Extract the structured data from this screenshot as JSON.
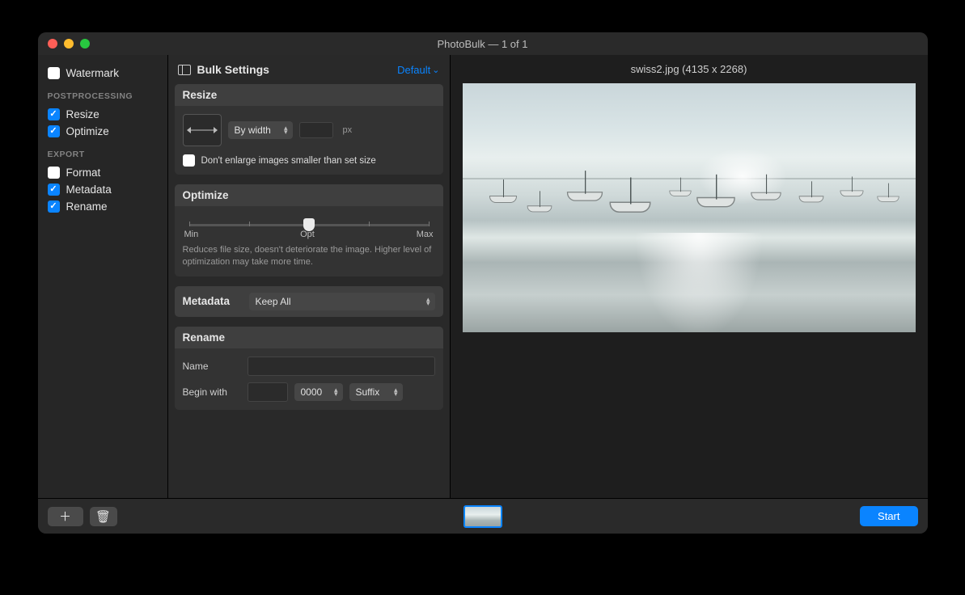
{
  "window": {
    "title": "PhotoBulk — 1 of 1"
  },
  "sidebar": {
    "watermark": {
      "label": "Watermark",
      "checked": false
    },
    "heading_post": "POSTPROCESSING",
    "resize": {
      "label": "Resize",
      "checked": true
    },
    "optimize": {
      "label": "Optimize",
      "checked": true
    },
    "heading_export": "EXPORT",
    "format": {
      "label": "Format",
      "checked": false
    },
    "metadata": {
      "label": "Metadata",
      "checked": true
    },
    "rename": {
      "label": "Rename",
      "checked": true
    }
  },
  "settings": {
    "header": "Bulk Settings",
    "preset": "Default",
    "resize": {
      "title": "Resize",
      "mode": "By width",
      "value": "",
      "unit": "px",
      "dont_enlarge_label": "Don't enlarge images smaller than set size",
      "dont_enlarge_checked": false
    },
    "optimize": {
      "title": "Optimize",
      "min": "Min",
      "opt": "Opt",
      "max": "Max",
      "value_pct": 50,
      "desc": "Reduces file size, doesn't deteriorate the image. Higher level of optimization may take more time."
    },
    "metadata": {
      "title": "Metadata",
      "mode": "Keep All"
    },
    "rename": {
      "title": "Rename",
      "name_label": "Name",
      "name_value": "",
      "begin_label": "Begin with",
      "begin_value": "",
      "digits": "0000",
      "position": "Suffix"
    }
  },
  "preview": {
    "filename": "swiss2.jpg",
    "dimensions": "(4135 x 2268)"
  },
  "bottombar": {
    "start": "Start"
  }
}
